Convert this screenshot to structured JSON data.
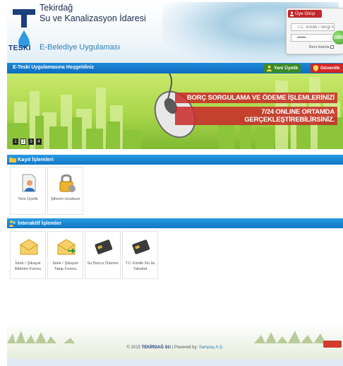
{
  "header": {
    "org_line1": "Tekirdağ",
    "org_line2": "Su ve Kanalizasyon İdaresi",
    "app_name": "E-Belediye Uygulaması",
    "logo_text": "TESKİ"
  },
  "login": {
    "title": "Üye Girişi",
    "tc_placeholder": "T.C. Kimlik / Vergi No",
    "password_value": "••••••",
    "remember_label": "Beni Hatırla",
    "go_label": "GİRİŞ"
  },
  "nav": {
    "welcome": "E-Teski Uygulamasına Hoşgeldiniz",
    "register_label": "Yeni Üyelik",
    "security_label": "Güvenlik"
  },
  "banner": {
    "line1": "BORÇ SORGULAMA VE ÖDEME İŞLEMLERİNİZİ",
    "line2": "7/24 ONLINE ORTAMDA GERÇEKLEŞTİREBİLİRSİNİZ.",
    "slides": [
      "1",
      "2",
      "3",
      "4"
    ],
    "active_slide": "1"
  },
  "sections": {
    "account": {
      "title": "Kayıt İşlemleri",
      "tiles": [
        {
          "label": "Yeni Üyelik",
          "icon": "user-document-icon"
        },
        {
          "label": "Şifremi Unuttum",
          "icon": "padlock-icon"
        }
      ]
    },
    "interactive": {
      "title": "İnteraktif İşlemler",
      "tiles": [
        {
          "label": "İstek / Şikayet Bildirim Formu",
          "icon": "envelope-icon"
        },
        {
          "label": "İstek / Şikayet Takip Formu",
          "icon": "envelope-arrow-icon"
        },
        {
          "label": "Su Borcu Ödeme",
          "icon": "credit-card-icon"
        },
        {
          "label": "T.C Kimlik No ile Tahsilat",
          "icon": "credit-card-icon"
        }
      ]
    }
  },
  "footer": {
    "copyright_prefix": "© 2015",
    "org": "TEKİRDAĞ SU",
    "powered_prefix": "| Powered by:",
    "vendor": "Sampaş A.Ş."
  },
  "colors": {
    "nav_blue": "#0d6dbf",
    "register_green": "#3a8a2a",
    "security_red": "#d22626",
    "banner_green": "#a8d64a",
    "brand_navy": "#1b3f7a"
  }
}
